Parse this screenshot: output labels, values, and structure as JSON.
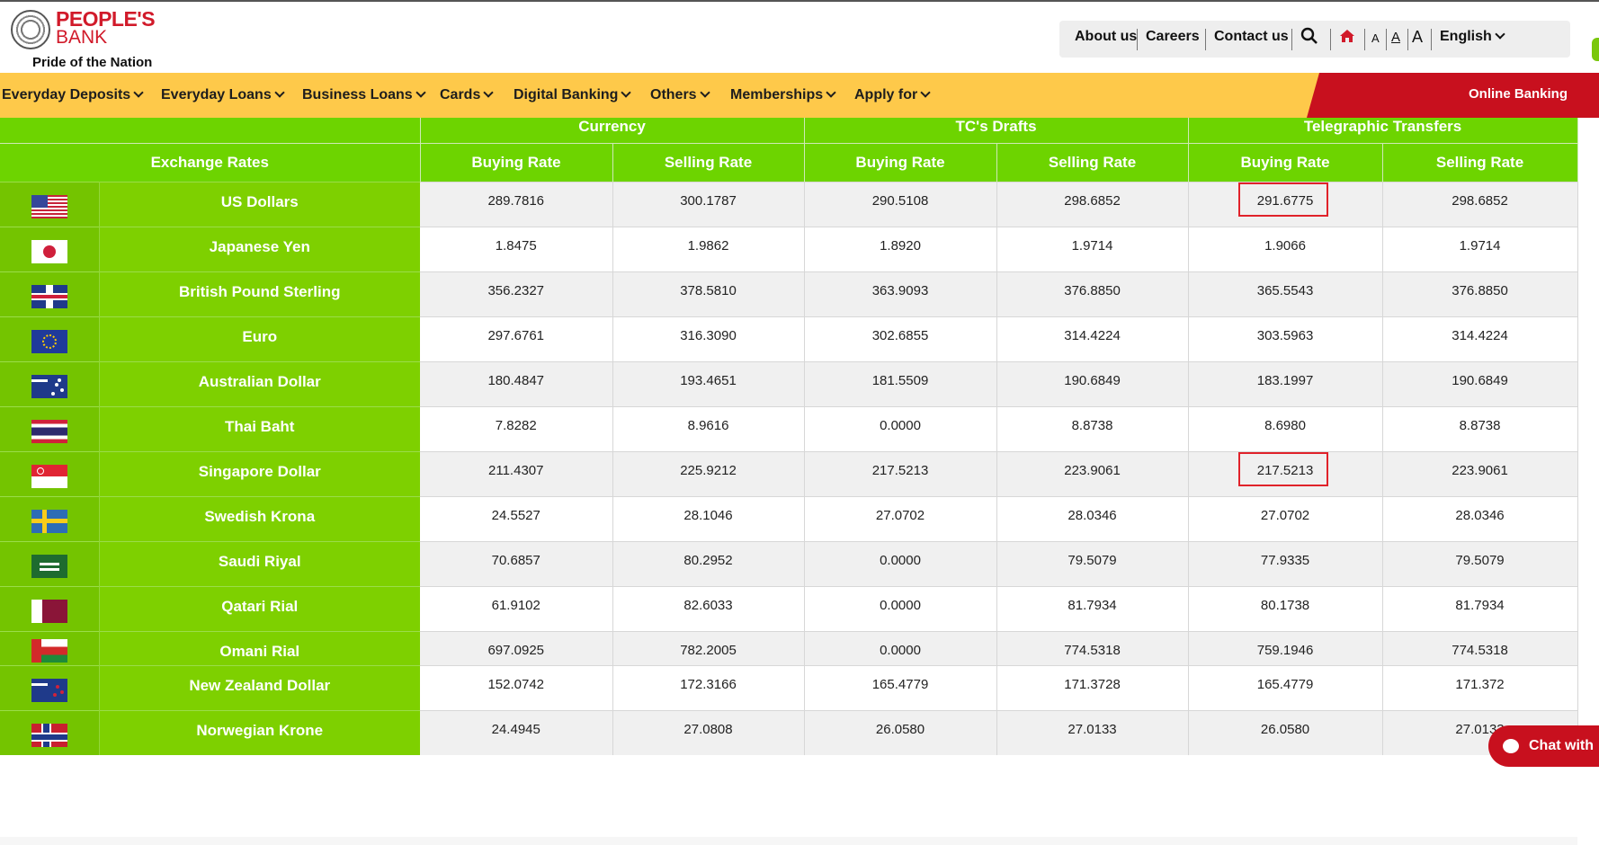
{
  "header": {
    "brand": "PEOPLE'S",
    "brand_sub": "BANK",
    "tagline": "Pride of the Nation",
    "top_links": [
      "About us",
      "Careers",
      "Contact us"
    ],
    "font_sizes": [
      "A",
      "A",
      "A"
    ],
    "language": "English"
  },
  "nav": {
    "items": [
      "Everyday Deposits",
      "Everyday Loans",
      "Business Loans",
      "Cards",
      "Digital Banking",
      "Others",
      "Memberships",
      "Apply for"
    ],
    "online_banking": "Online Banking"
  },
  "table": {
    "group_headers": [
      "Currency",
      "TC's Drafts",
      "Telegraphic Transfers"
    ],
    "exchange_rates_label": "Exchange Rates",
    "sub_headers": [
      "Buying Rate",
      "Selling Rate",
      "Buying Rate",
      "Selling Rate",
      "Buying Rate",
      "Selling Rate"
    ],
    "rows": [
      {
        "flag": "us-flag-icon",
        "name": "US Dollars",
        "values": [
          "289.7816",
          "300.1787",
          "290.5108",
          "298.6852",
          "291.6775",
          "298.6852"
        ]
      },
      {
        "flag": "jp-flag-icon",
        "name": "Japanese Yen",
        "values": [
          "1.8475",
          "1.9862",
          "1.8920",
          "1.9714",
          "1.9066",
          "1.9714"
        ]
      },
      {
        "flag": "gb-flag-icon",
        "name": "British Pound Sterling",
        "values": [
          "356.2327",
          "378.5810",
          "363.9093",
          "376.8850",
          "365.5543",
          "376.8850"
        ]
      },
      {
        "flag": "eu-flag-icon",
        "name": "Euro",
        "values": [
          "297.6761",
          "316.3090",
          "302.6855",
          "314.4224",
          "303.5963",
          "314.4224"
        ]
      },
      {
        "flag": "au-flag-icon",
        "name": "Australian Dollar",
        "values": [
          "180.4847",
          "193.4651",
          "181.5509",
          "190.6849",
          "183.1997",
          "190.6849"
        ]
      },
      {
        "flag": "th-flag-icon",
        "name": "Thai Baht",
        "values": [
          "7.8282",
          "8.9616",
          "0.0000",
          "8.8738",
          "8.6980",
          "8.8738"
        ]
      },
      {
        "flag": "sg-flag-icon",
        "name": "Singapore Dollar",
        "values": [
          "211.4307",
          "225.9212",
          "217.5213",
          "223.9061",
          "217.5213",
          "223.9061"
        ]
      },
      {
        "flag": "se-flag-icon",
        "name": "Swedish Krona",
        "values": [
          "24.5527",
          "28.1046",
          "27.0702",
          "28.0346",
          "27.0702",
          "28.0346"
        ]
      },
      {
        "flag": "sa-flag-icon",
        "name": "Saudi Riyal",
        "values": [
          "70.6857",
          "80.2952",
          "0.0000",
          "79.5079",
          "77.9335",
          "79.5079"
        ]
      },
      {
        "flag": "qa-flag-icon",
        "name": "Qatari Rial",
        "values": [
          "61.9102",
          "82.6033",
          "0.0000",
          "81.7934",
          "80.1738",
          "81.7934"
        ]
      },
      {
        "flag": "om-flag-icon",
        "name": "Omani Rial",
        "values": [
          "697.0925",
          "782.2005",
          "0.0000",
          "774.5318",
          "759.1946",
          "774.5318"
        ]
      },
      {
        "flag": "nz-flag-icon",
        "name": "New Zealand Dollar",
        "values": [
          "152.0742",
          "172.3166",
          "165.4779",
          "171.3728",
          "165.4779",
          "171.372"
        ]
      },
      {
        "flag": "no-flag-icon",
        "name": "Norwegian Krone",
        "values": [
          "24.4945",
          "27.0808",
          "26.0580",
          "27.0133",
          "26.0580",
          "27.0133"
        ]
      }
    ],
    "highlighted_cells": [
      {
        "row": 0,
        "col": 4
      },
      {
        "row": 6,
        "col": 4
      }
    ]
  },
  "chat": {
    "label": "Chat with"
  },
  "colors": {
    "nav_bg": "#fec94a",
    "brand_red": "#c8101e",
    "table_green": "#6dd400",
    "highlight": "#e0222a"
  }
}
